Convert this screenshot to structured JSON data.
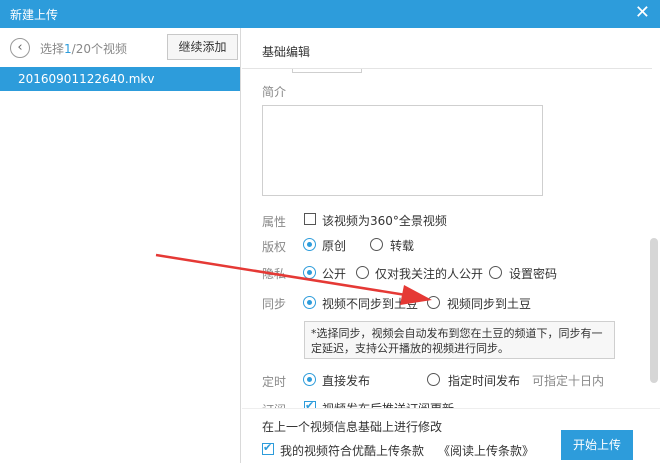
{
  "window": {
    "title": "新建上传",
    "close_glyph": "✕"
  },
  "sidebar": {
    "back_glyph": "‹",
    "count_prefix": "选择",
    "count_selected": "1",
    "count_suffix": "/20个视频",
    "continue_label": "继续添加",
    "files": [
      "20160901122640.mkv"
    ]
  },
  "form": {
    "section_title": "基础编辑",
    "intro_label": "简介",
    "attribute": {
      "label": "属性",
      "checkbox_label": "该视频为360°全景视频",
      "checked": false
    },
    "copyright": {
      "label": "版权",
      "options": [
        "原创",
        "转载"
      ],
      "selected": "原创"
    },
    "privacy": {
      "label": "隐私",
      "options": [
        "公开",
        "仅对我关注的人公开",
        "设置密码"
      ],
      "selected": "公开"
    },
    "sync": {
      "label": "同步",
      "options": [
        "视频不同步到土豆",
        "视频同步到土豆"
      ],
      "selected": "视频不同步到土豆"
    },
    "sync_note": "*选择同步，视频会自动发布到您在土豆的频道下，同步有一定延迟，支持公开播放的视频进行同步。",
    "timing": {
      "label": "定时",
      "options": [
        "直接发布",
        "指定时间发布"
      ],
      "selected": "直接发布",
      "hint": "可指定十日内"
    },
    "subscribe": {
      "label": "订阅",
      "checkbox_label": "视频发布后推送订阅更新",
      "checked": true
    }
  },
  "footer": {
    "modify_hint": "在上一个视频信息基础上进行修改",
    "agree_label": "我的视频符合优酷上传条款",
    "terms_link": "《阅读上传条款》",
    "agree_checked": true,
    "upload_label": "开始上传"
  },
  "colors": {
    "accent": "#2d9cdb",
    "arrow": "#e53935"
  },
  "icons": [
    "back-arrow-icon",
    "close-icon",
    "red-arrow-annotation"
  ]
}
